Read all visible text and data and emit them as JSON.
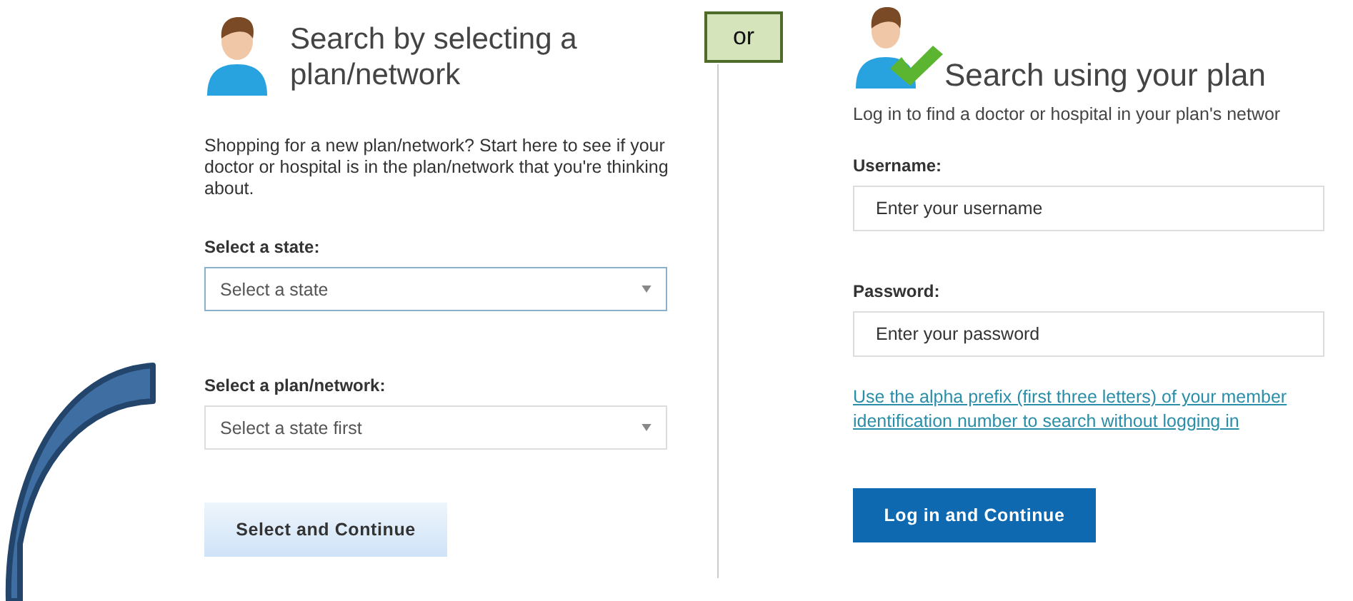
{
  "left": {
    "title": "Search by selecting a plan/network",
    "description": "Shopping for a new plan/network? Start here to see if your doctor or hospital is in the plan/network that you're thinking about.",
    "fields": [
      {
        "label": "Select a state:",
        "value": "Select a state",
        "focused": true
      },
      {
        "label": "Select a plan/network:",
        "value": "Select a state first",
        "focused": false
      }
    ],
    "button": "Select and Continue"
  },
  "separator": {
    "label": "or"
  },
  "right": {
    "title": "Search using your plan",
    "description": "Log in to find a doctor or hospital in your plan's networ",
    "fields": [
      {
        "label": "Username:",
        "placeholder": "Enter your username"
      },
      {
        "label": "Password:",
        "placeholder": "Enter your password"
      }
    ],
    "link": "Use the alpha prefix (first three letters) of your member identification number to search without logging in",
    "button": "Log in and Continue"
  }
}
